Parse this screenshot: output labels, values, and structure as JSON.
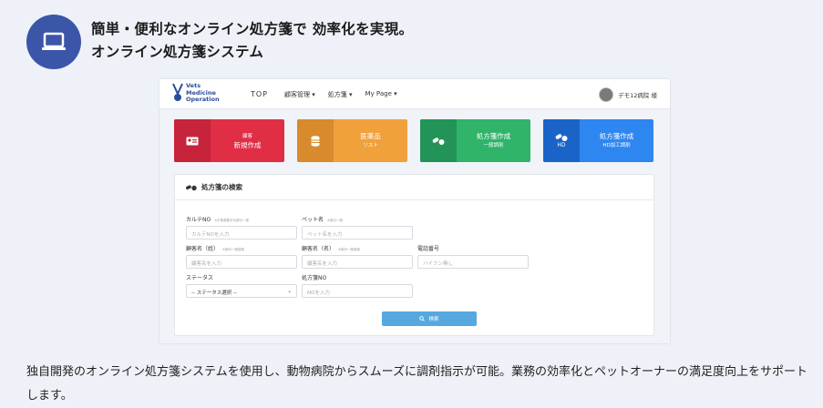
{
  "hero": {
    "icon": "laptop-icon",
    "title_line1": "簡単・便利なオンライン処方箋で 効率化を実現。",
    "title_line2": "オンライン処方箋システム"
  },
  "app": {
    "logo": {
      "line1": "Vets",
      "line2": "Medicine",
      "line3": "Operation"
    },
    "nav": {
      "top": "TOP",
      "customers": "顧客管理",
      "prescriptions": "処方箋",
      "mypage": "My Page"
    },
    "user": {
      "name": "デモ12病院 様"
    },
    "cards": [
      {
        "icon": "id-card-icon",
        "label": "顧客",
        "sub": "新規作成",
        "icon_text": ""
      },
      {
        "icon": "database-icon",
        "label": "医薬品",
        "sub": "リスト",
        "icon_text": ""
      },
      {
        "icon": "pills-icon",
        "label": "処方箋作成",
        "sub": "一般調剤",
        "icon_text": ""
      },
      {
        "icon": "pills-icon",
        "label": "処方箋作成",
        "sub": "HD加工調剤",
        "icon_text": "HD"
      }
    ],
    "search": {
      "title": "処方箋の検索",
      "fields": {
        "karte": {
          "label": "カルテNO",
          "hint": "※半角英数字の部分一致",
          "placeholder": "カルテNOを入力"
        },
        "pet": {
          "label": "ペット名",
          "hint": "※部分一致",
          "placeholder": "ペット名を入力"
        },
        "last": {
          "label": "顧客名（姓）",
          "hint": "※部分一致検索",
          "placeholder": "顧客名を入力"
        },
        "first": {
          "label": "顧客名（名）",
          "hint": "※部分一致検索",
          "placeholder": "顧客名を入力"
        },
        "phone": {
          "label": "電話番号",
          "hint": "",
          "placeholder": "ハイフン無し"
        },
        "status": {
          "label": "ステータス",
          "value": "-- ステータス選択 --"
        },
        "rxno": {
          "label": "処方箋NO",
          "placeholder": "NOを入力"
        }
      },
      "button": "検索"
    }
  },
  "caption": "独自開発のオンライン処方箋システムを使用し、動物病院からスムーズに調剤指示が可能。業務の効率化とペットオーナーの満足度向上をサポートします。"
}
